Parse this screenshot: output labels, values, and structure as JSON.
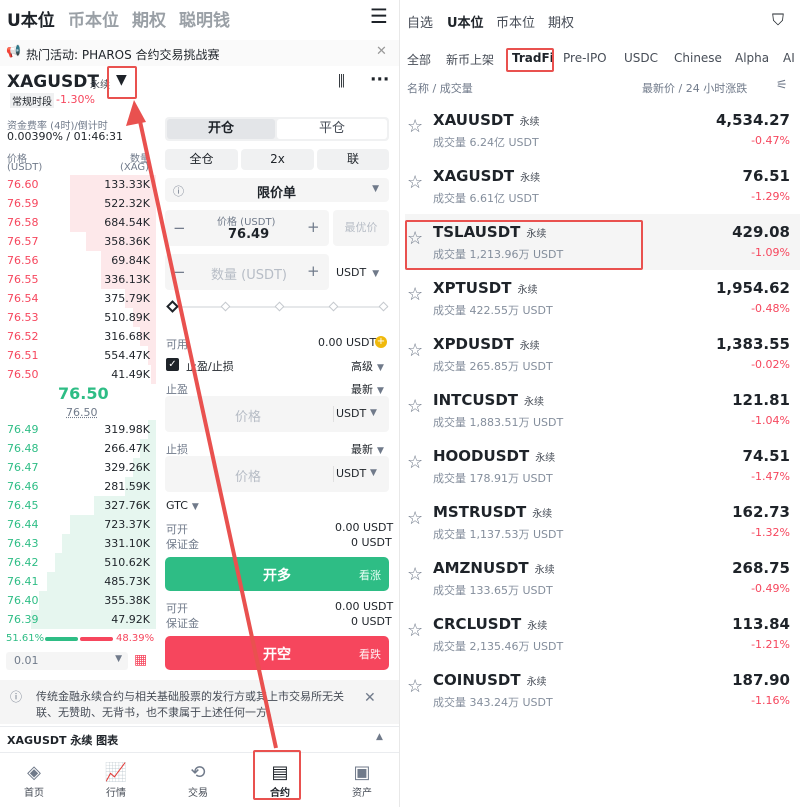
{
  "left": {
    "top_tabs": [
      "U本位",
      "币本位",
      "期权",
      "聪明钱"
    ],
    "menu_icon": "menu-icon",
    "banner": {
      "text": "热门活动: PHAROS 合约交易挑战赛",
      "icon": "megaphone-icon"
    },
    "symbol": "XAGUSDT",
    "symbol_tag": "永续",
    "session": "常规时段",
    "change": "-1.30%",
    "funding_label": "资金费率 (4时)/倒计时",
    "funding_value": "0.00390% / 01:46:31",
    "ob_headers": {
      "price": "价格",
      "price_unit": "(USDT)",
      "qty": "数量",
      "qty_unit": "(XAG)"
    },
    "asks": [
      {
        "p": "76.60",
        "q": "133.33K",
        "depth": 0.55
      },
      {
        "p": "76.59",
        "q": "522.32K",
        "depth": 0.55
      },
      {
        "p": "76.58",
        "q": "684.54K",
        "depth": 0.55
      },
      {
        "p": "76.57",
        "q": "358.36K",
        "depth": 0.45
      },
      {
        "p": "76.56",
        "q": "69.84K",
        "depth": 0.35
      },
      {
        "p": "76.55",
        "q": "336.13K",
        "depth": 0.35
      },
      {
        "p": "76.54",
        "q": "375.79K",
        "depth": 0.2
      },
      {
        "p": "76.53",
        "q": "510.89K",
        "depth": 0.15
      },
      {
        "p": "76.52",
        "q": "316.68K",
        "depth": 0.1
      },
      {
        "p": "76.51",
        "q": "554.47K",
        "depth": 0.05
      },
      {
        "p": "76.50",
        "q": "41.49K",
        "depth": 0.03
      }
    ],
    "mid_price": "76.50",
    "mark_price": "76.50",
    "bids": [
      {
        "p": "76.49",
        "q": "319.98K",
        "depth": 0.05
      },
      {
        "p": "76.48",
        "q": "266.47K",
        "depth": 0.1
      },
      {
        "p": "76.47",
        "q": "329.26K",
        "depth": 0.15
      },
      {
        "p": "76.46",
        "q": "281.59K",
        "depth": 0.2
      },
      {
        "p": "76.45",
        "q": "327.76K",
        "depth": 0.4
      },
      {
        "p": "76.44",
        "q": "723.37K",
        "depth": 0.55
      },
      {
        "p": "76.43",
        "q": "331.10K",
        "depth": 0.6
      },
      {
        "p": "76.42",
        "q": "510.62K",
        "depth": 0.65
      },
      {
        "p": "76.41",
        "q": "485.73K",
        "depth": 0.7
      },
      {
        "p": "76.40",
        "q": "355.38K",
        "depth": 0.75
      },
      {
        "p": "76.39",
        "q": "47.92K",
        "depth": 0.8
      }
    ],
    "buy_pct": "51.61%",
    "sell_pct": "48.39%",
    "step": "0.01",
    "open_tab": "开仓",
    "close_tab": "平仓",
    "margin_mode": "全仓",
    "leverage": "2x",
    "combo": "联",
    "order_type": "限价单",
    "price_label": "价格 (USDT)",
    "price_value": "76.49",
    "best_price": "最优价",
    "qty_placeholder": "数量 (USDT)",
    "unit": "USDT",
    "available_label": "可用",
    "available_value": "0.00 USDT",
    "tpsl_label": "止盈/止损",
    "advanced": "高级",
    "tp_label": "止盈",
    "latest": "最新",
    "price_ph": "价格",
    "sl_label": "止损",
    "gtc": "GTC",
    "open_label": "可开",
    "margin_label": "保证金",
    "long_open": "0.00 USDT",
    "long_margin": "0 USDT",
    "long_btn": "开多",
    "long_hint": "看涨",
    "short_open": "0.00 USDT",
    "short_margin": "0 USDT",
    "short_btn": "开空",
    "short_hint": "看跌",
    "notice": "传统金融永续合约与相关基础股票的发行方或其上市交易所无关联、无赞助、无背书，也不隶属于上述任何一方。",
    "chart_bar": "XAGUSDT 永续 图表",
    "nav": [
      {
        "label": "首页",
        "icon": "home-icon"
      },
      {
        "label": "行情",
        "icon": "market-icon"
      },
      {
        "label": "交易",
        "icon": "trade-icon"
      },
      {
        "label": "合约",
        "icon": "futures-icon"
      },
      {
        "label": "资产",
        "icon": "wallet-icon"
      }
    ]
  },
  "right": {
    "top_tabs": [
      "自选",
      "U本位",
      "币本位",
      "期权"
    ],
    "filter_icon": "filter-icon",
    "categories": [
      "全部",
      "新币上架",
      "TradFi",
      "Pre-IPO",
      "USDC",
      "Chinese",
      "Alpha",
      "AI"
    ],
    "sort_left": "名称 / 成交量",
    "sort_right": "最新价 / 24 小时涨跌",
    "tag": "永续",
    "rows": [
      {
        "sym": "XAUUSDT",
        "vol": "成交量 6.24亿 USDT",
        "price": "4,534.27",
        "chg": "-0.47%"
      },
      {
        "sym": "XAGUSDT",
        "vol": "成交量 6.61亿 USDT",
        "price": "76.51",
        "chg": "-1.29%"
      },
      {
        "sym": "TSLAUSDT",
        "vol": "成交量 1,213.96万 USDT",
        "price": "429.08",
        "chg": "-1.09%"
      },
      {
        "sym": "XPTUSDT",
        "vol": "成交量 422.55万 USDT",
        "price": "1,954.62",
        "chg": "-0.48%"
      },
      {
        "sym": "XPDUSDT",
        "vol": "成交量 265.85万 USDT",
        "price": "1,383.55",
        "chg": "-0.02%"
      },
      {
        "sym": "INTCUSDT",
        "vol": "成交量 1,883.51万 USDT",
        "price": "121.81",
        "chg": "-1.04%"
      },
      {
        "sym": "HOODUSDT",
        "vol": "成交量 178.91万 USDT",
        "price": "74.51",
        "chg": "-1.47%"
      },
      {
        "sym": "MSTRUSDT",
        "vol": "成交量 1,137.53万 USDT",
        "price": "162.73",
        "chg": "-1.32%"
      },
      {
        "sym": "AMZNUSDT",
        "vol": "成交量 133.65万 USDT",
        "price": "268.75",
        "chg": "-0.49%"
      },
      {
        "sym": "CRCLUSDT",
        "vol": "成交量 2,135.46万 USDT",
        "price": "113.84",
        "chg": "-1.21%"
      },
      {
        "sym": "COINUSDT",
        "vol": "成交量 343.24万 USDT",
        "price": "187.90",
        "chg": "-1.16%"
      }
    ]
  },
  "colors": {
    "green": "#2ebd85",
    "red": "#f6465d",
    "annotation": "#e9514f"
  }
}
